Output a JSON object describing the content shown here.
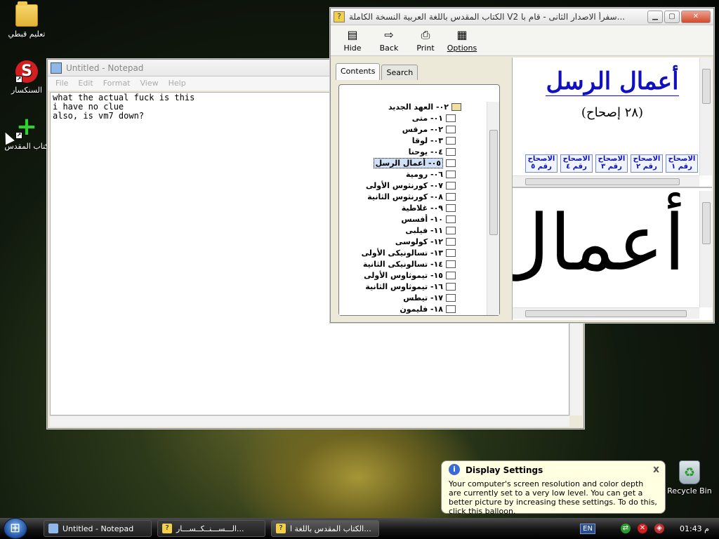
{
  "desktop": {
    "icons": [
      {
        "label": "تعليم قبطي",
        "icon": "folder-icon"
      },
      {
        "label": "السنكسار",
        "icon": "synaxarium-icon"
      },
      {
        "label": "كتاب المقدس",
        "icon": "bible-plus-icon"
      }
    ],
    "recycle_bin": {
      "label": "Recycle Bin",
      "icon": "recycle-bin-icon"
    }
  },
  "notepad": {
    "title": "Untitled - Notepad",
    "menu": [
      "File",
      "Edit",
      "Format",
      "View",
      "Help"
    ],
    "text": "what the actual fuck is this\ni have no clue\nalso, is vm7 down?"
  },
  "help_window": {
    "title": "الكتاب المقدس باللغة العربية النسخة الكاملة V2 سفرأ الاصدار الثانى - قام با...",
    "toolbar": [
      {
        "label": "Hide",
        "icon": "hide-icon"
      },
      {
        "label": "Back",
        "icon": "back-arrow-icon"
      },
      {
        "label": "Print",
        "icon": "printer-icon"
      },
      {
        "label": "Options",
        "icon": "options-icon"
      }
    ],
    "tabs": [
      "Contents",
      "Search"
    ],
    "tree": {
      "root": "٠٢- العهد الجديد",
      "items": [
        "٠١- متى",
        "٠٢- مرقس",
        "٠٣- لوقا",
        "٠٤- يوحنا",
        "٠٥- أعمال الرسل",
        "٠٦- رومية",
        "٠٧- كورنثوس الأولى",
        "٠٨- كورنثوس الثانية",
        "٠٩- غلاطية",
        "١٠- أفسس",
        "١١- فيلبى",
        "١٢- كولوسى",
        "١٣- تسالونيكى الأولى",
        "١٤- تسالونيكى الثانية",
        "١٥- تيموثاوس الأولى",
        "١٦- تيموثاوس الثانية",
        "١٧- تيطس",
        "١٨- فليمون"
      ],
      "selected": "٠٥- أعمال الرسل"
    },
    "content": {
      "title": "أعمال الرسل",
      "subtitle": "(٢٨ إصحاح)",
      "chapter_links": [
        "الاصحاح رقم ١",
        "الاصحاح رقم ٢",
        "الاصحاح رقم ٣",
        "الاصحاح رقم ٤",
        "الاصحاح رقم ٥"
      ],
      "big_word": "أعمال"
    }
  },
  "balloon": {
    "title": "Display Settings",
    "text": "Your computer's screen resolution and color depth are currently set to a very low level. You can get a better picture by increasing these settings. To do this, click this balloon.",
    "close": "x"
  },
  "taskbar": {
    "tasks": [
      {
        "label": "Untitled - Notepad"
      },
      {
        "label": "الـــســـنــكــســـار..."
      },
      {
        "label": "الكتاب المقدس باللغة ا..."
      }
    ],
    "language": "EN",
    "clock": "م 01:43"
  }
}
